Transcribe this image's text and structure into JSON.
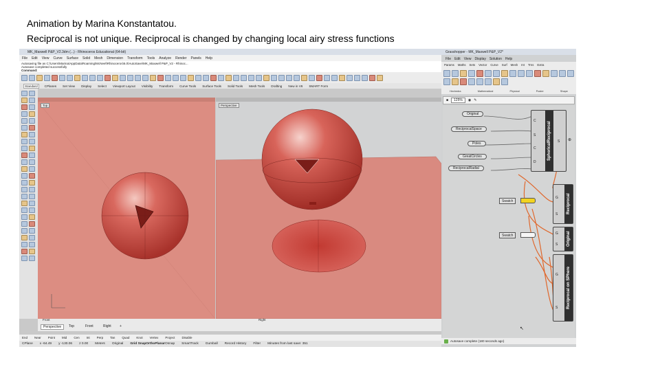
{
  "caption": {
    "line1": "Animation by Marina Konstantatou.",
    "line2": "Reciprocal is not unique. Reciprocal is changed by changing local airy stress functions"
  },
  "rhino": {
    "title": "MK_Maxwell P&P_V2.3dm (...) - Rhinoceros Educational (64-bit)",
    "menu": [
      "File",
      "Edit",
      "View",
      "Curve",
      "Surface",
      "Solid",
      "Mesh",
      "Dimension",
      "Transform",
      "Tools",
      "Analyze",
      "Render",
      "Panels",
      "Help"
    ],
    "command_history": [
      "Autosaving file as C:\\Users\\Marina\\AppData\\Roaming\\McNeel\\Rhinoceros\\6.0\\AutoSave\\MK_Maxwell P&P_V2 - Rhinoc...",
      "Autosaving file as C:\\Users\\Marina\\AppData\\Roaming\\...\\AutoSave\\...",
      "Autosave completed successfully"
    ],
    "command_prompt": "Command:",
    "toolbar_tabs": [
      "Standard",
      "CPlanes",
      "Set View",
      "Display",
      "Select",
      "Viewport Layout",
      "Visibility",
      "Transform",
      "Curve Tools",
      "Surface Tools",
      "Solid Tools",
      "Mesh Tools",
      "Drafting",
      "New in V6",
      "SMART Form"
    ],
    "viewport_left_label": "Top",
    "viewport_right_label": "Perspective",
    "viewport_tabs": [
      "Perspective",
      "Top",
      "Front",
      "Right"
    ],
    "viewport_bottom_left_label": "Front",
    "viewport_bottom_right_label": "Right",
    "osnap": [
      "End",
      "Near",
      "Point",
      "Mid",
      "Cen",
      "Int",
      "Perp",
      "Tan",
      "Quad",
      "Knot",
      "Vertex",
      "Project",
      "Disable"
    ],
    "status": {
      "cplane": "CPlane",
      "x": "x -64.49",
      "y": "y -130.06",
      "z": "z 0.00",
      "units": "Meters",
      "layer": "Original",
      "grid_snap": "Grid Snap",
      "ortho": "Ortho",
      "planar": "Planar",
      "osnap": "Osnap",
      "smarttrack": "SmartTrack",
      "gumball": "Gumball",
      "record_history": "Record History",
      "filter": "Filter",
      "minutes": "Minutes from last save: 351"
    }
  },
  "grasshopper": {
    "title": "Grasshopper - MK_Maxwell P&P_V2*",
    "menu": [
      "File",
      "Edit",
      "View",
      "Display",
      "Solution",
      "Help"
    ],
    "tabs": [
      "Params",
      "Maths",
      "Sets",
      "Vector",
      "Curve",
      "Surf",
      "Mesh",
      "Int",
      "Trns",
      "Extra"
    ],
    "group_labels": [
      "Hexhedra",
      "Mathematical",
      "Physical",
      "Poster",
      "Shape"
    ],
    "zoom": "125%",
    "params": [
      "Original",
      "ReciprocalSpace",
      "Poles",
      "GreatCircles",
      "ReciprocalRadial"
    ],
    "components": {
      "spherical": "SphericalReciprocal",
      "reciprocal": "Reciprocal",
      "original": "Original",
      "on_sphere": "Reciprocal on SPhere"
    },
    "spherical_inputs": [
      "C",
      "S",
      "C",
      "D"
    ],
    "spherical_output": "S",
    "gs": [
      "G",
      "S"
    ],
    "switch_label": "Swatch",
    "status": "Autosave complete (180 seconds ago)",
    "colors": {
      "wire_orange": "#e0662a",
      "toggle_yellow": "#f2d321",
      "viewport_red": "#dc8d82",
      "sphere_red": "#c9473f"
    }
  }
}
